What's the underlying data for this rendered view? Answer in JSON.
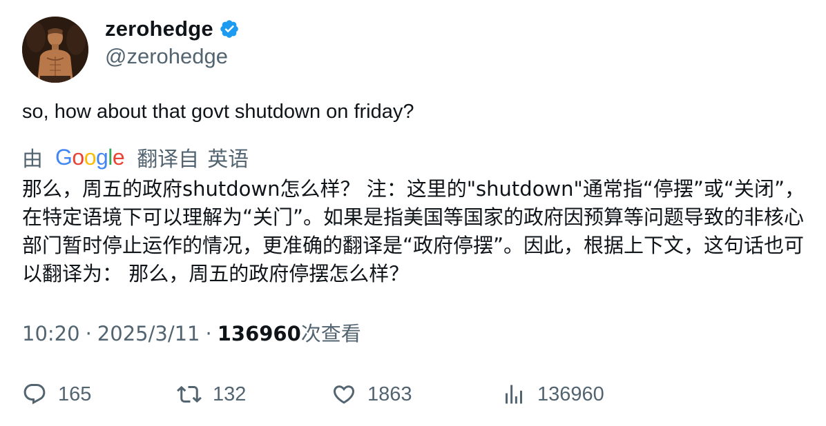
{
  "author": {
    "display_name": "zerohedge",
    "handle": "@zerohedge",
    "verified": true,
    "avatar_icon": "avatar"
  },
  "tweet": {
    "text": "so, how about that govt shutdown on friday?"
  },
  "translation": {
    "by_label": "由",
    "provider": "Google",
    "source_label": "翻译自",
    "source_language": "英语",
    "text": "那么，周五的政府shutdown怎么样？ 注：这里的\"shutdown\"通常指“停摆”或“关闭”，在特定语境下可以理解为“关门”。如果是指美国等国家的政府因预算等问题导致的非核心部门暂时停止运作的情况，更准确的翻译是“政府停摆”。因此，根据上下文，这句话也可以翻译为： 那么，周五的政府停摆怎么样？"
  },
  "meta": {
    "time": "10:20",
    "separator": "·",
    "date": "2025/3/11",
    "views_count": "136960",
    "views_label": "次查看"
  },
  "actions": {
    "replies": "165",
    "retweets": "132",
    "likes": "1863",
    "views": "136960"
  },
  "colors": {
    "text_primary": "#0f1419",
    "text_secondary": "#536471",
    "verified_blue": "#1d9bf0",
    "background": "#ffffff"
  },
  "icons": [
    "verified-badge-icon",
    "reply-icon",
    "retweet-icon",
    "like-icon",
    "views-icon"
  ]
}
